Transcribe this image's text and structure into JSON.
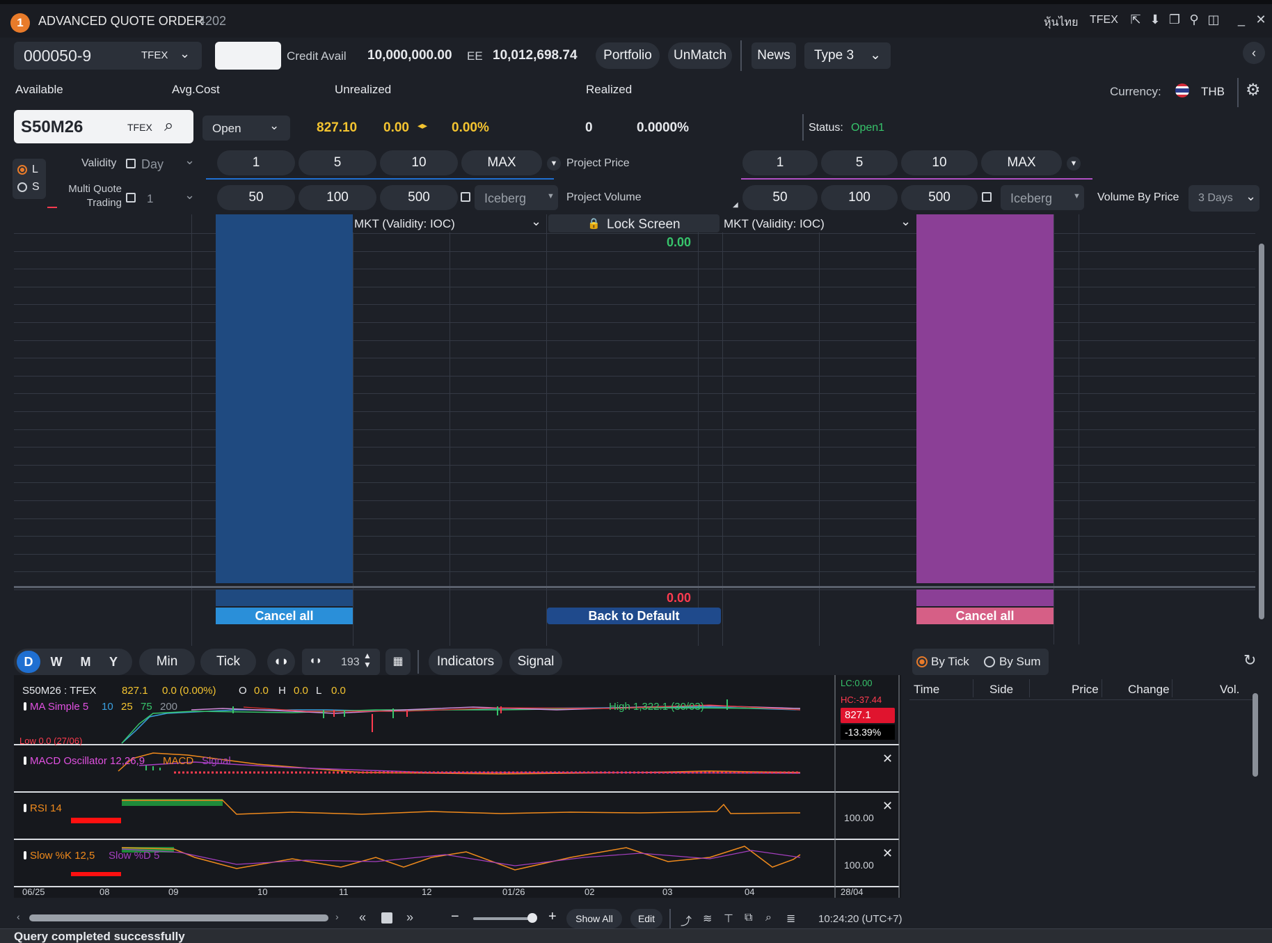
{
  "title": {
    "badge": "1",
    "app": "ADVANCED QUOTE ORDER",
    "code": "4202",
    "lang": "หุ้นไทย",
    "market": "TFEX"
  },
  "account": {
    "number": "000050-9",
    "market": "TFEX",
    "credit_label": "Credit Avail",
    "credit_value": "10,000,000.00",
    "ee_label": "EE",
    "ee_value": "10,012,698.74"
  },
  "top_buttons": {
    "portfolio": "Portfolio",
    "unmatch": "UnMatch",
    "news": "News",
    "type": "Type 3"
  },
  "headers": {
    "available": "Available",
    "avg_cost": "Avg.Cost",
    "unrealized": "Unrealized",
    "realized": "Realized",
    "currency_label": "Currency:",
    "currency": "THB"
  },
  "symbol": {
    "name": "S50M26",
    "market": "TFEX",
    "position": "Open",
    "price": "827.10",
    "change": "0.00",
    "pct": "0.00%",
    "realized": "0",
    "realized_pct": "0.0000%",
    "status_label": "Status:",
    "status": "Open1"
  },
  "controls": {
    "long": "L",
    "short": "S",
    "validity": "Validity",
    "day": "Day",
    "multi_quote": "Multi Quote Trading",
    "multi_value": "1",
    "project_price": "Project Price",
    "project_volume": "Project  Volume",
    "iceberg": "Iceberg",
    "volume_by_price": "Volume By Price",
    "days": "3 Days"
  },
  "qty_buttons_row1": [
    "1",
    "5",
    "10",
    "MAX"
  ],
  "qty_buttons_row2": [
    "50",
    "100",
    "500"
  ],
  "ladder": {
    "buy_type": "MKT (Validity: IOC)",
    "sell_type": "MKT (Validity: IOC)",
    "lock": "Lock Screen",
    "top_value": "0.00",
    "bottom_value": "0.00",
    "cancel_buy": "Cancel all",
    "back_default": "Back to Default",
    "cancel_sell": "Cancel all"
  },
  "chart_toolbar": {
    "periods": [
      "D",
      "W",
      "M",
      "Y"
    ],
    "min": "Min",
    "tick": "Tick",
    "count": "193",
    "indicators": "Indicators",
    "signal": "Signal"
  },
  "chart": {
    "header": "S50M26 : TFEX",
    "last": "827.1",
    "chg": "0.0 (0.00%)",
    "o_label": "O",
    "o": "0.0",
    "h_label": "H",
    "h": "0.0",
    "l_label": "L",
    "l": "0.0",
    "ma_label": "MA Simple 5",
    "ma2": "10",
    "ma3": "25",
    "ma4": "75",
    "ma5": "200",
    "high_label": "High 1,322.1 (30/03)",
    "low_label": "Low 0.0 (27/06)",
    "lc": "LC:0.00",
    "hc": "HC:-37.44",
    "price_tag": "827.1",
    "pct_tag": "-13.39%",
    "macd_label": "MACD Oscillator 12,26,9",
    "macd": "MACD",
    "signal": "Signal",
    "rsi_label": "RSI 14",
    "rsi_val": "100.00",
    "stoch_label": "Slow %K 12,5",
    "stoch_d": "Slow %D 5",
    "stoch_val": "100.00",
    "x_ticks": [
      "06/25",
      "08",
      "09",
      "10",
      "11",
      "12",
      "01/26",
      "02",
      "03",
      "04",
      "28/04"
    ],
    "show_all": "Show All",
    "edit": "Edit",
    "time": "10:24:20 (UTC+7)"
  },
  "ticker": {
    "by_tick": "By Tick",
    "by_sum": "By Sum",
    "cols": [
      "Time",
      "Side",
      "Price",
      "Change",
      "Vol."
    ]
  },
  "status_bar": "Query completed successfully"
}
